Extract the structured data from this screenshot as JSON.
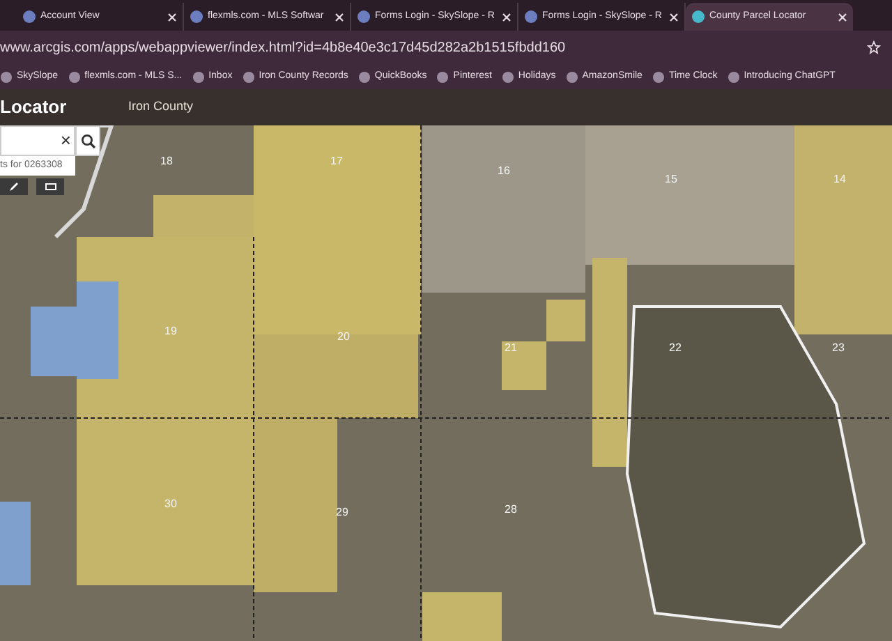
{
  "tabs": [
    {
      "title": "Account View",
      "selected": false
    },
    {
      "title": "flexmls.com - MLS Softwar",
      "selected": false
    },
    {
      "title": "Forms Login - SkySlope - R",
      "selected": false
    },
    {
      "title": "Forms Login - SkySlope - R",
      "selected": false
    },
    {
      "title": "County Parcel Locator",
      "selected": true
    }
  ],
  "address_bar": {
    "url": "www.arcgis.com/apps/webappviewer/index.html?id=4b8e40e3c17d45d282a2b1515fbdd160"
  },
  "bookmarks": [
    "SkySlope",
    "flexmls.com - MLS S...",
    "Inbox",
    "Iron County Records",
    "QuickBooks",
    "Pinterest",
    "Holidays",
    "AmazonSmile",
    "Time Clock",
    "Introducing ChatGPT"
  ],
  "app_header": {
    "title": "Locator",
    "subtitle": "Iron County"
  },
  "search": {
    "clear": "×",
    "hint": "ts for 0263308"
  },
  "map_labels": [
    "18",
    "17",
    "16",
    "15",
    "14",
    "19",
    "20",
    "21",
    "22",
    "23",
    "30",
    "29",
    "28"
  ]
}
